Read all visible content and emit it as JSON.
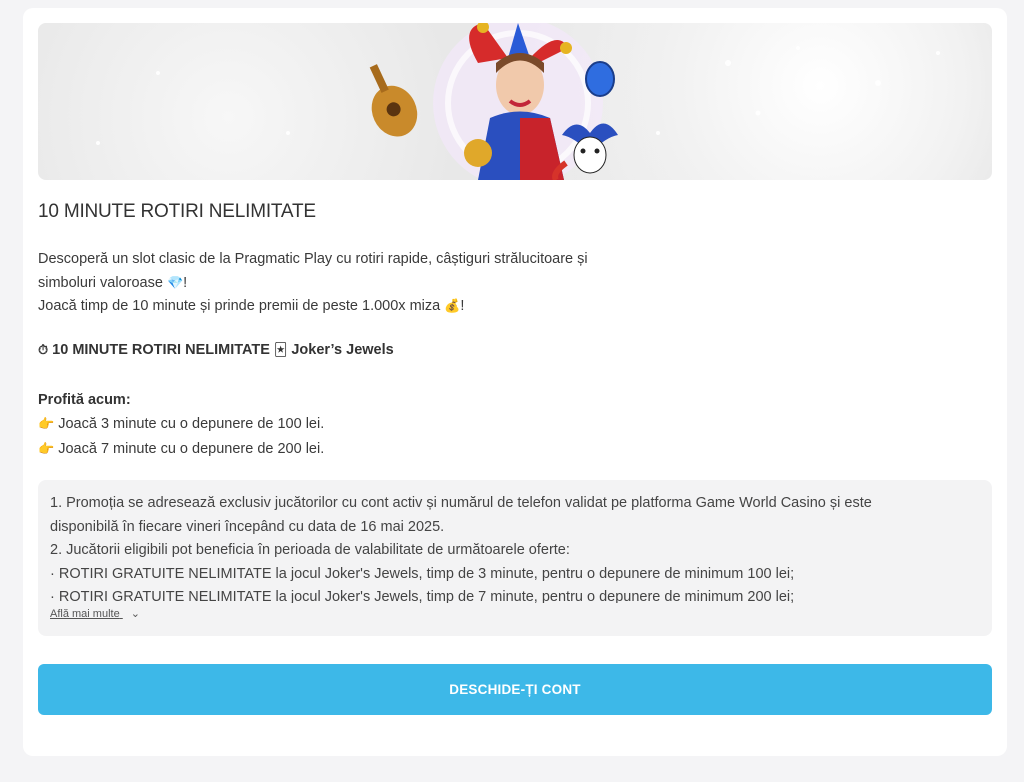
{
  "promo": {
    "title": "10 MINUTE ROTIRI NELIMITATE",
    "description": {
      "line1": "Descoperă un slot clasic de la Pragmatic Play cu rotiri rapide, câștiguri strălucitoare și",
      "line2a": "simboluri valoroase",
      "line2_emoji": "💎",
      "line2b": "!",
      "line3a": "Joacă timp de 10 minute și prinde premii de peste 1.000x miza",
      "line3_emoji": "💰",
      "line3b": "!"
    },
    "game_line": {
      "timer_emoji": "⏱",
      "label": "10 MINUTE ROTIRI NELIMITATE",
      "card_emoji": "🃏",
      "game_name": "Joker’s Jewels"
    },
    "profit": {
      "heading": "Profită acum:",
      "items": [
        {
          "emoji": "👉",
          "text": "Joacă 3 minute cu o depunere de 100 lei."
        },
        {
          "emoji": "👉",
          "text": "Joacă 7 minute cu o depunere de 200 lei."
        }
      ]
    }
  },
  "terms": {
    "lines": [
      "1. Promoția se adresează exclusiv jucătorilor cu cont activ și numărul de telefon validat pe platforma Game World Casino și este",
      "disponibilă în fiecare vineri începând cu data de 16 mai 2025.",
      "2. Jucătorii eligibili pot beneficia în perioada de valabilitate de următoarele oferte:",
      "· ROTIRI GRATUITE NELIMITATE la jocul Joker's Jewels, timp de 3 minute, pentru o depunere de minimum 100 lei;",
      "· ROTIRI GRATUITE NELIMITATE la jocul Joker's Jewels, timp de 7 minute, pentru o depunere de minimum 200 lei;"
    ],
    "more_label": "Află mai multe"
  },
  "cta": {
    "label": "DESCHIDE-ȚI CONT"
  },
  "colors": {
    "accent": "#3db8e8",
    "page_bg": "#f4f4f6",
    "terms_bg": "#f3f3f4"
  }
}
